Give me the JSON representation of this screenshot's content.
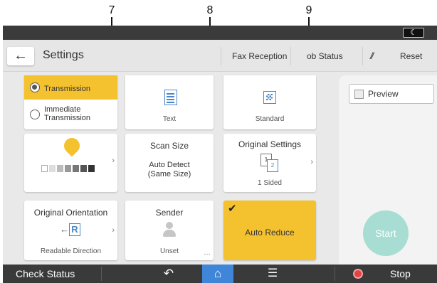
{
  "callouts": [
    "7",
    "8",
    "9"
  ],
  "header": {
    "title": "Settings",
    "buttons": [
      "Fax Reception",
      "ob Status",
      "Reset"
    ]
  },
  "cards": {
    "transmission": {
      "selected_label": "Transmission",
      "option_label": "Immediate\nTransmission"
    },
    "scan_type": {
      "value": "Text"
    },
    "resolution": {
      "value": "Standard"
    },
    "density": {},
    "scan_size": {
      "title": "Scan Size",
      "value": "Auto Detect\n(Same Size)"
    },
    "original_settings": {
      "title": "Original Settings",
      "value": "1 Sided"
    },
    "original_orientation": {
      "title": "Original Orientation",
      "value": "Readable Direction"
    },
    "sender": {
      "title": "Sender",
      "value": "Unset"
    },
    "auto_reduce": {
      "title": "Auto Reduce"
    }
  },
  "panel": {
    "preview_label": "Preview",
    "start_label": "Start"
  },
  "bottom": {
    "check_status": "Check Status",
    "stop": "Stop"
  },
  "colors": {
    "accent_yellow": "#f5c22f",
    "start_teal": "#a7ddd2",
    "home_blue": "#3f86d8",
    "stop_red": "#e04545"
  }
}
